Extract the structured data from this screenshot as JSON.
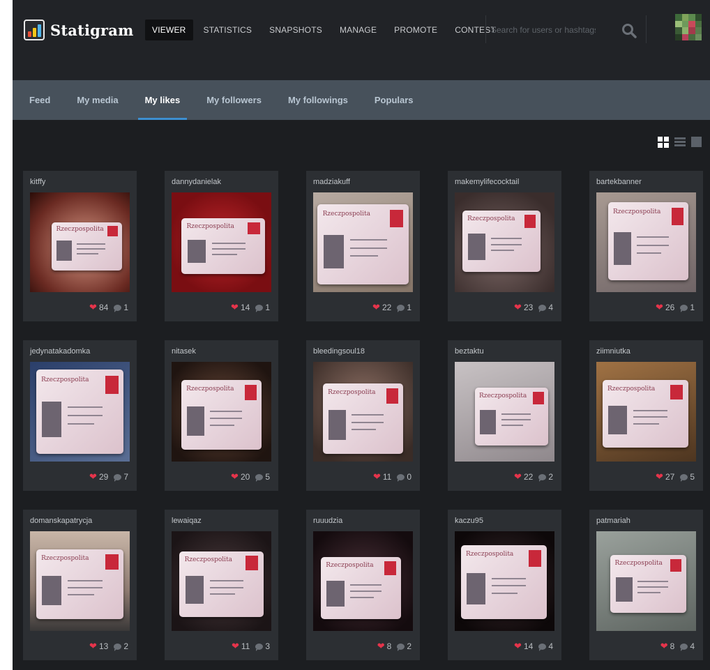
{
  "app": {
    "name": "Statigram"
  },
  "nav": [
    "VIEWER",
    "STATISTICS",
    "SNAPSHOTS",
    "MANAGE",
    "PROMOTE",
    "CONTEST"
  ],
  "nav_active": "VIEWER",
  "search": {
    "placeholder": "Search for users or hashtags"
  },
  "tabs": [
    "Feed",
    "My media",
    "My likes",
    "My followers",
    "My followings",
    "Populars"
  ],
  "tabs_active": "My likes",
  "colors": {
    "accent": "#3d8fd1",
    "heart": "#e5344b",
    "background": "#1c1e21",
    "subnav": "#47515b"
  },
  "posts": [
    {
      "user": "kitffy",
      "likes": "84",
      "comments": "1"
    },
    {
      "user": "dannydanielak",
      "likes": "14",
      "comments": "1"
    },
    {
      "user": "madziakuff",
      "likes": "22",
      "comments": "1"
    },
    {
      "user": "makemylifecocktail",
      "likes": "23",
      "comments": "4"
    },
    {
      "user": "bartekbanner",
      "likes": "26",
      "comments": "1"
    },
    {
      "user": "jedynatakadomka",
      "likes": "29",
      "comments": "7"
    },
    {
      "user": "nitasek",
      "likes": "20",
      "comments": "5"
    },
    {
      "user": "bleedingsoul18",
      "likes": "11",
      "comments": "0"
    },
    {
      "user": "beztaktu",
      "likes": "22",
      "comments": "2"
    },
    {
      "user": "ziimniutka",
      "likes": "27",
      "comments": "5"
    },
    {
      "user": "domanskapatrycja",
      "likes": "13",
      "comments": "2"
    },
    {
      "user": "lewaiqaz",
      "likes": "11",
      "comments": "3"
    },
    {
      "user": "ruuudzia",
      "likes": "8",
      "comments": "2"
    },
    {
      "user": "kaczu95",
      "likes": "14",
      "comments": "4"
    },
    {
      "user": "patmariah",
      "likes": "8",
      "comments": "4"
    }
  ],
  "card_text": {
    "id_title": "Rzeczpospolita"
  }
}
